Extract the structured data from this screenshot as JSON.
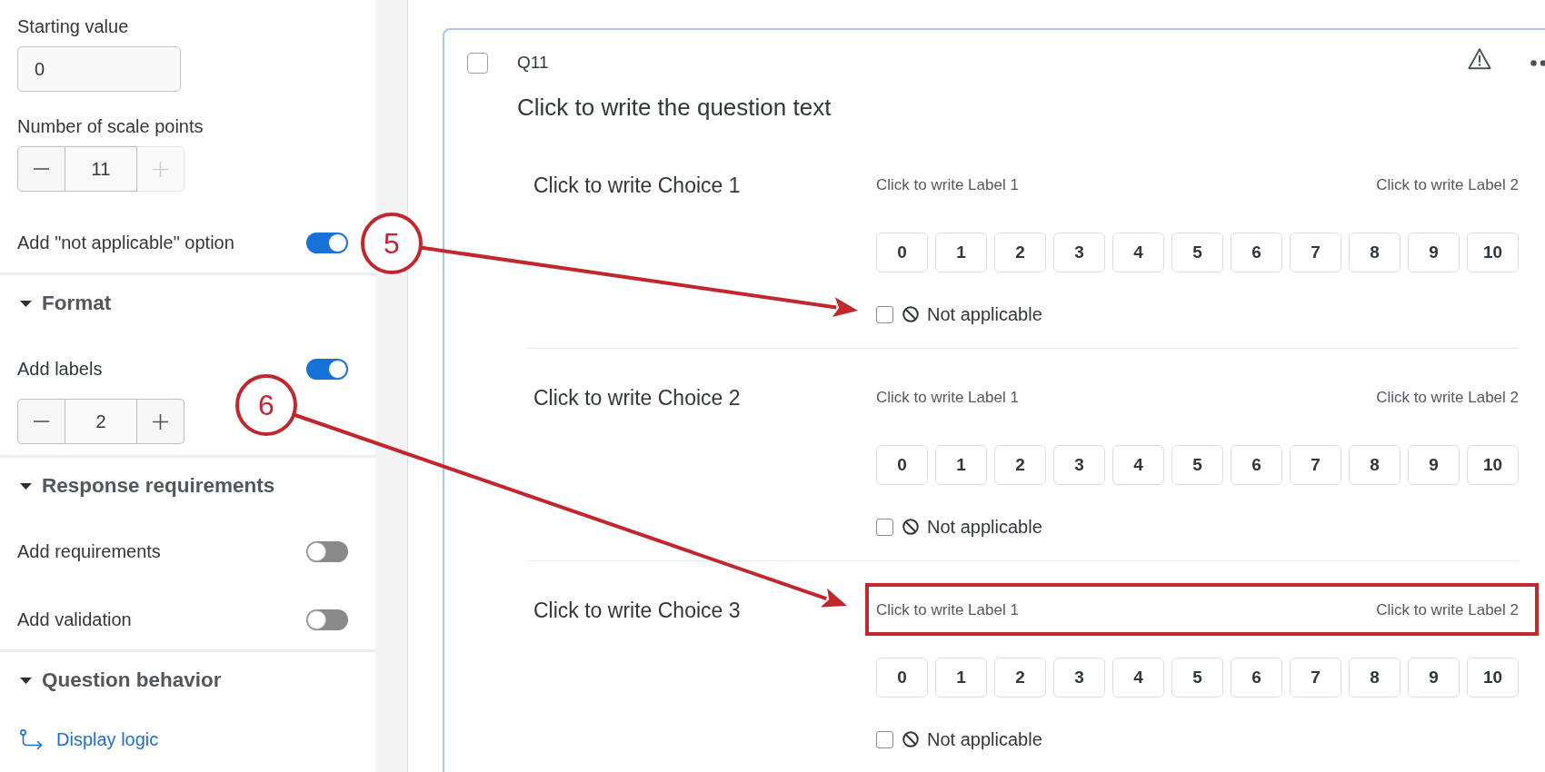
{
  "sidebar": {
    "sections": [
      {
        "items": [
          {
            "kind": "text_input",
            "label": "Starting value",
            "value": "0"
          },
          {
            "kind": "stepper",
            "label": "Number of scale points",
            "value": "11",
            "plus_disabled": true
          },
          {
            "kind": "toggle",
            "label": "Add \"not applicable\" option",
            "on": true
          }
        ]
      },
      {
        "title": "Format",
        "expanded": true,
        "items": [
          {
            "kind": "toggle",
            "label": "Add labels",
            "on": true
          },
          {
            "kind": "stepper",
            "value": "2",
            "plus_disabled": false
          }
        ]
      },
      {
        "title": "Response requirements",
        "expanded": true,
        "items": [
          {
            "kind": "toggle",
            "label": "Add requirements",
            "on": false
          },
          {
            "kind": "toggle",
            "label": "Add validation",
            "on": false
          }
        ]
      },
      {
        "title": "Question behavior",
        "expanded": true,
        "items": [
          {
            "kind": "link",
            "label": "Display logic"
          }
        ]
      }
    ]
  },
  "question": {
    "checked": false,
    "number": "Q11",
    "text": "Click to write the question text",
    "rows": [
      {
        "choice": "Click to write Choice 1",
        "labels": [
          "Click to write Label 1",
          "Click to write Label 2"
        ],
        "scale": [
          {
            "label": "0",
            "selected": false
          },
          {
            "label": "1",
            "selected": false
          },
          {
            "label": "2",
            "selected": false
          },
          {
            "label": "3",
            "selected": false
          },
          {
            "label": "4",
            "selected": false
          },
          {
            "label": "5",
            "selected": false
          },
          {
            "label": "6",
            "selected": false
          },
          {
            "label": "7",
            "selected": false
          },
          {
            "label": "8",
            "selected": false
          },
          {
            "label": "9",
            "selected": false
          },
          {
            "label": "10",
            "selected": false
          }
        ],
        "not_applicable": {
          "label": "Not applicable",
          "checked": false
        },
        "highlighted": false,
        "callout": {
          "kind": "not_applicable",
          "number": "5"
        }
      },
      {
        "choice": "Click to write Choice 2",
        "labels": [
          "Click to write Label 1",
          "Click to write Label 2"
        ],
        "scale": [
          {
            "label": "0",
            "selected": false
          },
          {
            "label": "1",
            "selected": false
          },
          {
            "label": "2",
            "selected": false
          },
          {
            "label": "3",
            "selected": false
          },
          {
            "label": "4",
            "selected": false
          },
          {
            "label": "5",
            "selected": false
          },
          {
            "label": "6",
            "selected": false
          },
          {
            "label": "7",
            "selected": false
          },
          {
            "label": "8",
            "selected": false
          },
          {
            "label": "9",
            "selected": false
          },
          {
            "label": "10",
            "selected": false
          }
        ],
        "not_applicable": {
          "label": "Not applicable",
          "checked": false
        },
        "highlighted": false
      },
      {
        "choice": "Click to write Choice 3",
        "labels": [
          "Click to write Label 1",
          "Click to write Label 2"
        ],
        "scale": [
          {
            "label": "0",
            "selected": false
          },
          {
            "label": "1",
            "selected": false
          },
          {
            "label": "2",
            "selected": false
          },
          {
            "label": "3",
            "selected": false
          },
          {
            "label": "4",
            "selected": false
          },
          {
            "label": "5",
            "selected": false
          },
          {
            "label": "6",
            "selected": false
          },
          {
            "label": "7",
            "selected": false
          },
          {
            "label": "8",
            "selected": false
          },
          {
            "label": "9",
            "selected": false
          },
          {
            "label": "10",
            "selected": false
          }
        ],
        "not_applicable": {
          "label": "Not applicable",
          "checked": false
        },
        "highlighted": true,
        "callout": {
          "kind": "labels",
          "number": "6"
        }
      }
    ]
  }
}
